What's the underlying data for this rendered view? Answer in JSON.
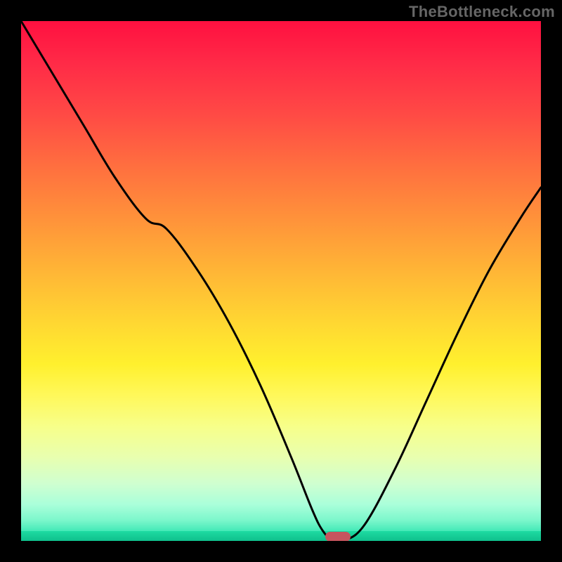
{
  "watermark": "TheBottleneck.com",
  "colors": {
    "gradient_top": "#ff1040",
    "gradient_bottom": "#1edba2",
    "marker": "#c6555e",
    "curve": "#000000",
    "frame_bg": "#000000"
  },
  "chart_data": {
    "type": "line",
    "title": "",
    "xlabel": "",
    "ylabel": "",
    "xlim": [
      0,
      100
    ],
    "ylim": [
      0,
      100
    ],
    "grid": false,
    "legend": false,
    "series": [
      {
        "name": "bottleneck-curve",
        "x": [
          0,
          6,
          12,
          18,
          24,
          28,
          34,
          40,
          46,
          52,
          56,
          58,
          60,
          62,
          66,
          72,
          78,
          84,
          90,
          96,
          100
        ],
        "y": [
          100,
          90,
          80,
          70,
          62,
          60,
          52,
          42,
          30,
          16,
          6,
          2,
          0,
          0,
          3,
          14,
          27,
          40,
          52,
          62,
          68
        ]
      }
    ],
    "marker": {
      "x": 61,
      "y": 0
    }
  }
}
